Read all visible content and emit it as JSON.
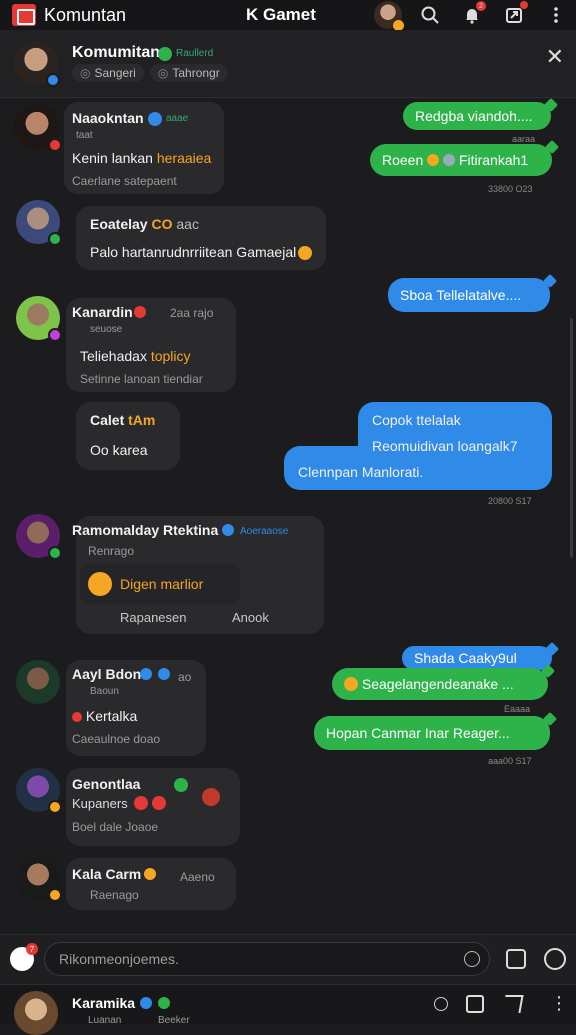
{
  "topbar": {
    "app_title": "Komuntan",
    "center_title": "K Gamet",
    "icons": [
      "search-icon",
      "bell-icon",
      "share-icon",
      "menu-icon"
    ],
    "bell_badge": "2"
  },
  "channel": {
    "name": "Komumitan",
    "tag": "Raullerd",
    "pill1": "Sangeri",
    "pill2": "Tahrongr"
  },
  "messages": {
    "m1": {
      "name": "Naaokntan",
      "tag": "aaae",
      "sub": "taat",
      "text1": "Kenin lankan",
      "text1_gold": "heraaiea",
      "text2": "Caerlane satepaent"
    },
    "m2": {
      "name": "Eoatelay",
      "name_gold": "CO",
      "tag": "aac",
      "text": "Palo hartanrudnrriitean Gamaejal"
    },
    "m3": {
      "name": "Kanardin",
      "tag": "2aa rajo",
      "sub": "seuose",
      "text1": "Teliehadax",
      "text1_gold": "toplicy",
      "text2": "Setinne lanoan tiendiar"
    },
    "m4": {
      "name": "Calet",
      "name_gold": "tAm",
      "text": "Oo karea"
    },
    "m5": {
      "name": "Ramomalday Rtektina",
      "tag": "Aoeraaose",
      "sub": "Renrago",
      "inner": "Digen marlior",
      "foot1": "Rapanesen",
      "foot2": "Anook"
    },
    "m6": {
      "name": "Aayl Bdon",
      "tag": "ao",
      "sub": "Baoun",
      "text1": "Kertalka",
      "text2": "Caeaulnoe doao"
    },
    "m7": {
      "name": "Genontlaa",
      "sub": "Kupaners",
      "text": "Boel dale Joaoe"
    },
    "m8": {
      "name": "Kala Carm",
      "tag": "Aaeno",
      "sub": "Raenago"
    }
  },
  "outgoing": {
    "o1": "Redgba viandoh....",
    "o2": "Roeen",
    "o2b": "Fitirankah1",
    "o3": "Sboa Tellelatalve....",
    "o4a": "Copok ttelalak",
    "o4b": "Reomuidivan loangalk7",
    "o4c": "Clennpan Manlorati.",
    "o5": "Shada Caaky9ul",
    "o6": "Seagelangendeanake ...",
    "o7": "Hopan Canmar Inar Reager..."
  },
  "times": {
    "t1": "aaraa",
    "t2": "33800 O23",
    "t3": "20800 S17",
    "t4": "Eaaaa",
    "t5": "aaa00 S17"
  },
  "composer": {
    "placeholder": "Rikonmeonjoemes.",
    "left_badge": "7"
  },
  "bottombar": {
    "name": "Karamika",
    "sub1": "Luanan",
    "sub2": "Beeker"
  },
  "colors": {
    "green": "#2db34a",
    "blue": "#2f8ae8",
    "gold": "#f5a623",
    "bg": "#1c1c1e",
    "red": "#e53935"
  }
}
